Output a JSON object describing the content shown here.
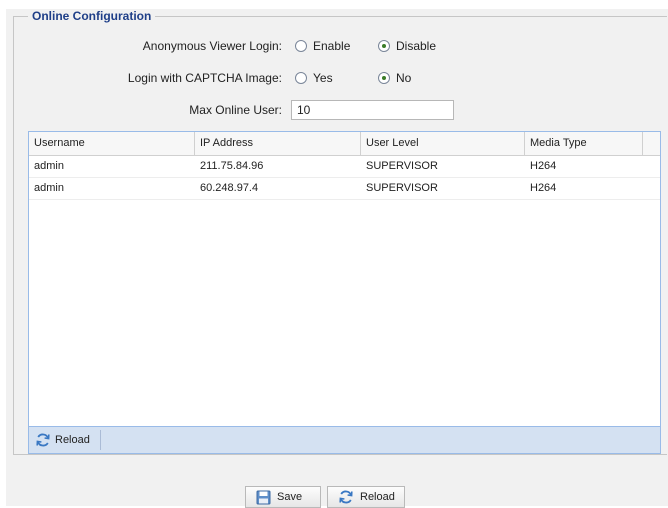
{
  "fieldset": {
    "legend": "Online Configuration"
  },
  "anonymous_login": {
    "label": "Anonymous Viewer Login:",
    "options": [
      "Enable",
      "Disable"
    ],
    "selected": "Disable"
  },
  "captcha_login": {
    "label": "Login with CAPTCHA Image:",
    "options": [
      "Yes",
      "No"
    ],
    "selected": "No"
  },
  "max_online_user": {
    "label": "Max Online User:",
    "value": "10"
  },
  "grid": {
    "columns": [
      "Username",
      "IP Address",
      "User Level",
      "Media Type"
    ],
    "rows": [
      [
        "admin",
        "211.75.84.96",
        "SUPERVISOR",
        "H264"
      ],
      [
        "admin",
        "60.248.97.4",
        "SUPERVISOR",
        "H264"
      ]
    ],
    "toolbar_reload_label": "Reload"
  },
  "footer": {
    "save_label": "Save",
    "reload_label": "Reload"
  },
  "icons": {
    "reload": "refresh-icon",
    "save": "floppy-disk-icon"
  },
  "colors": {
    "legend": "#1f3f88",
    "grid_border": "#99bbe8",
    "toolbar_bg": "#d4e1f2",
    "radio_dot": "#3b7c28"
  }
}
